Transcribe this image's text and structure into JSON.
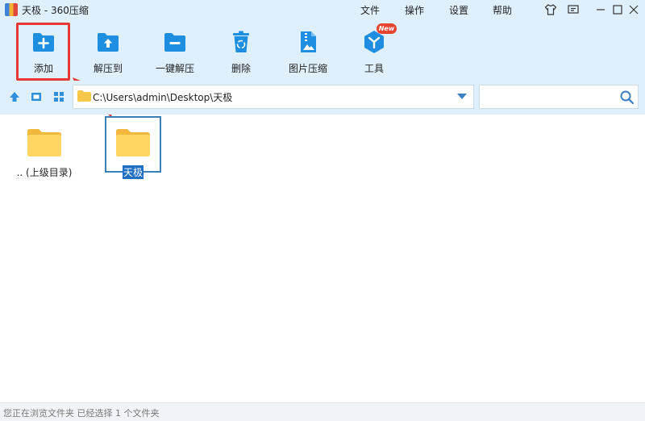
{
  "window": {
    "title": "天极 - 360压缩"
  },
  "menu": [
    "文件",
    "操作",
    "设置",
    "帮助"
  ],
  "toolbar": {
    "add": "添加",
    "extract_to": "解压到",
    "one_click_extract": "一键解压",
    "delete": "删除",
    "image_compress": "图片压缩",
    "tools": "工具",
    "tools_badge": "New"
  },
  "address": {
    "path": "C:\\Users\\admin\\Desktop\\天极",
    "search_value": ""
  },
  "files": [
    {
      "name": ".. (上级目录)",
      "selected": false
    },
    {
      "name": "天极",
      "selected": true
    }
  ],
  "status": {
    "text": "您正在浏览文件夹 已经选择 1 个文件夹"
  },
  "colors": {
    "accent": "#1e8fe0",
    "highlight": "#e53935",
    "selection": "#1e6fc4",
    "folder": "#f7c84a",
    "badge": "#e8432d"
  }
}
